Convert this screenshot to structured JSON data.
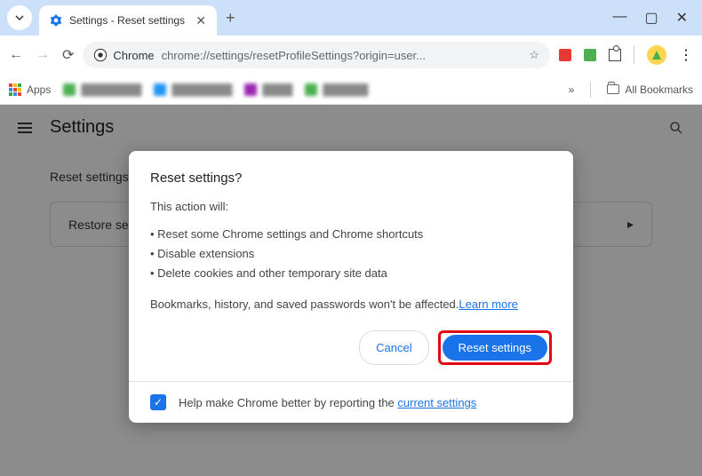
{
  "browser": {
    "tab_title": "Settings - Reset settings",
    "url": "chrome://settings/resetProfileSettings?origin=user...",
    "chrome_label": "Chrome",
    "apps_label": "Apps",
    "all_bookmarks": "All Bookmarks"
  },
  "page": {
    "settings_heading": "Settings",
    "section_title": "Reset settings",
    "row_label": "Restore settings to their original defaults"
  },
  "dialog": {
    "title": "Reset settings?",
    "intro": "This action will:",
    "bullet1": "• Reset some Chrome settings and Chrome shortcuts",
    "bullet2": "• Disable extensions",
    "bullet3": "• Delete cookies and other temporary site data",
    "note": "Bookmarks, history, and saved passwords won't be affected.",
    "learn_more": "Learn more",
    "cancel": "Cancel",
    "confirm": "Reset settings",
    "footer_text": "Help make Chrome better by reporting the ",
    "footer_link": "current settings"
  }
}
